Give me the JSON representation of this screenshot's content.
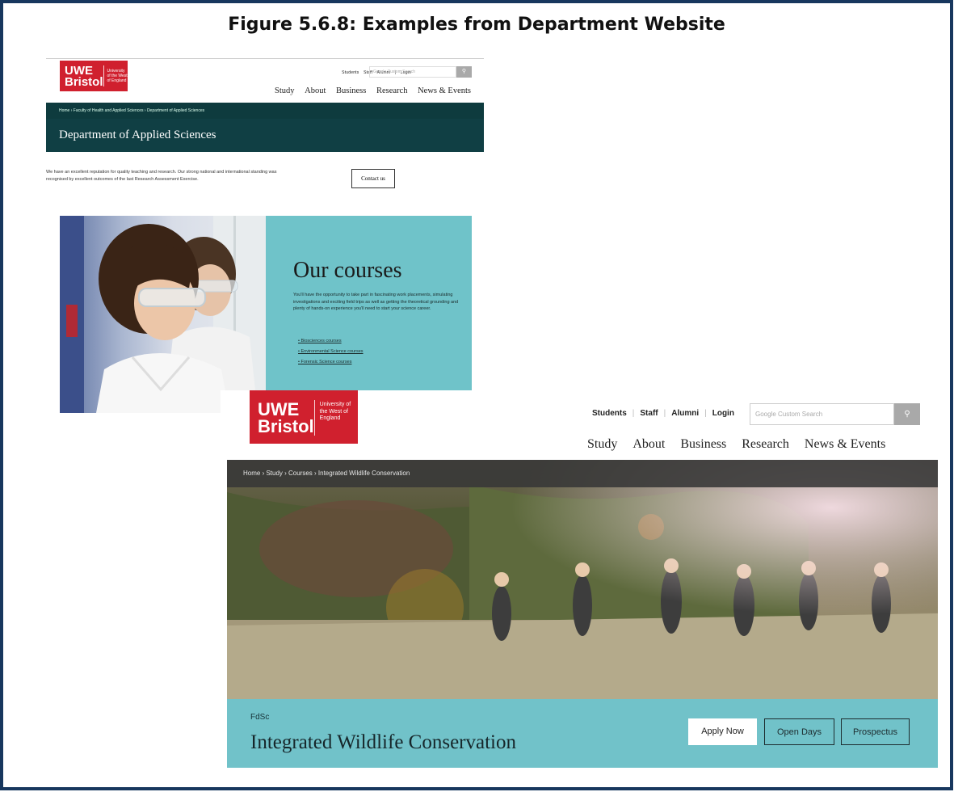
{
  "figure_title": "Figure 5.6.8: Examples from Department Website",
  "shot1": {
    "logo": {
      "main": "UWE Bristol",
      "sub": "University of the West of England"
    },
    "utility_links": [
      "Students",
      "Staff",
      "Alumni",
      "|",
      "Login"
    ],
    "search_placeholder": "Google Custom Search",
    "search_icon": "search-icon",
    "nav": [
      "Study",
      "About",
      "Business",
      "Research",
      "News & Events"
    ],
    "breadcrumb": "Home › Faculty of Health and Applied Sciences › Department of Applied Sciences",
    "banner_title": "Department of Applied Sciences",
    "intro": "We have an excellent reputation for quality teaching and research. Our strong national and international standing was recognised by excellent outcomes of the last Research Assessment Exercise.",
    "contact_button": "Contact us",
    "courses": {
      "heading": "Our courses",
      "text": "You'll have the opportunity to take part in fascinating work placements, simulating investigations and exciting field trips as well as getting the theoretical grounding and plenty of hands-on experience you'll need to start your science career.",
      "links": [
        "Biosciences courses",
        "Environmental Science courses",
        "Forensic Science courses"
      ]
    }
  },
  "shot2": {
    "logo": {
      "main": "UWE Bristol",
      "sub": "University of the West of England"
    },
    "utility_links": [
      "Students",
      "Staff",
      "Alumni",
      "Login"
    ],
    "search_placeholder": "Google Custom Search",
    "search_icon": "search-icon",
    "nav": [
      "Study",
      "About",
      "Business",
      "Research",
      "News & Events"
    ],
    "breadcrumb": "Home  ›  Study  ›  Courses  ›  Integrated Wildlife Conservation",
    "course_type": "FdSc",
    "course_title": "Integrated Wildlife Conservation",
    "buttons": {
      "apply": "Apply Now",
      "open_days": "Open Days",
      "prospectus": "Prospectus"
    }
  },
  "colors": {
    "brand_red": "#d0202e",
    "dark_teal": "#103f44",
    "teal": "#6fc3c9",
    "frame": "#17375e"
  }
}
